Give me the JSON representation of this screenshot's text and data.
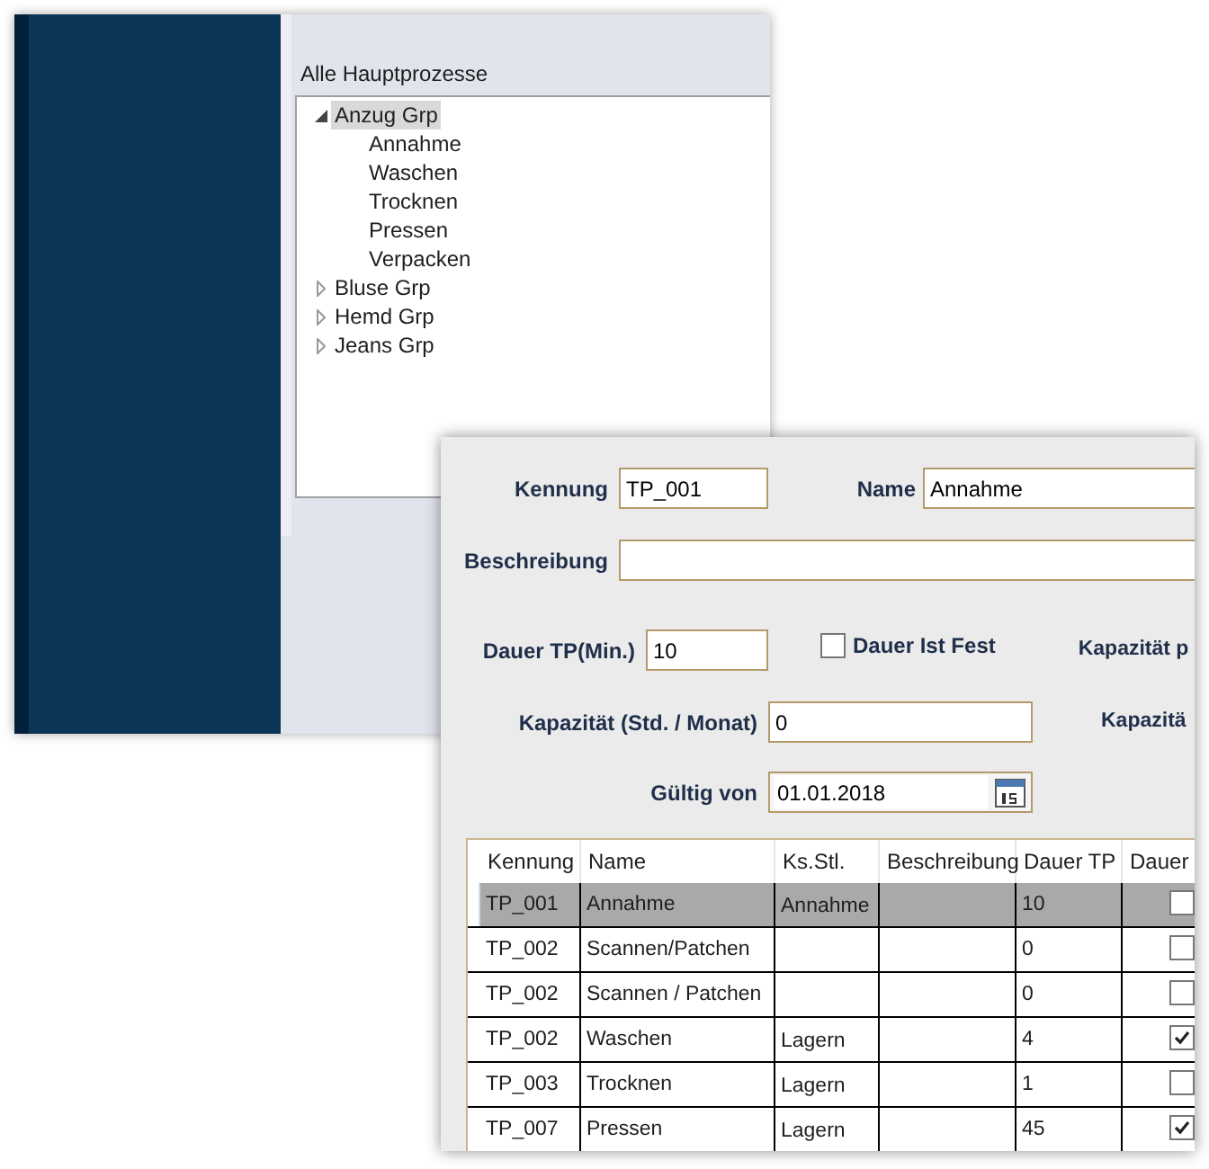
{
  "back_window": {
    "tree_title": "Alle Hauptprozesse",
    "tree": [
      {
        "label": "Anzug Grp",
        "expanded": true,
        "selected": true,
        "children": [
          {
            "label": "Annahme",
            "selected": false
          },
          {
            "label": "Waschen",
            "selected": false
          },
          {
            "label": "Trocknen",
            "selected": false
          },
          {
            "label": "Pressen",
            "selected": false
          },
          {
            "label": "Verpacken",
            "selected": false
          }
        ]
      },
      {
        "label": "Bluse Grp",
        "expanded": false,
        "selected": false
      },
      {
        "label": "Hemd Grp",
        "expanded": false,
        "selected": false
      },
      {
        "label": "Jeans Grp",
        "expanded": false,
        "selected": false
      }
    ]
  },
  "form": {
    "kennung": {
      "label": "Kennung",
      "value": "TP_001"
    },
    "name": {
      "label": "Name",
      "value": "Annahme"
    },
    "beschreibung": {
      "label": "Beschreibung"
    },
    "dauer": {
      "label": "Dauer TP(Min.)",
      "value": "10"
    },
    "dauer_fest": {
      "label": "Dauer Ist Fest",
      "checked": false
    },
    "kapazitaet_p_label": "Kapazität p",
    "kapazitaet": {
      "label": "Kapazität (Std. / Monat)",
      "value": "0"
    },
    "kapazitaet_2_label": "Kapazitä",
    "gueltig": {
      "label": "Gültig von",
      "value": "01.01.2018"
    }
  },
  "table": {
    "columns": [
      "Kennung",
      "Name",
      "Ks.Stl.",
      "Beschreibung",
      "Dauer TP",
      "Dauer"
    ],
    "rows": [
      {
        "cells": [
          "TP_001",
          "Annahme",
          "Annahme",
          "",
          "10"
        ],
        "checked": false,
        "selected": true
      },
      {
        "cells": [
          "TP_002",
          "Scannen/Patchen",
          "",
          "",
          "0"
        ],
        "checked": false,
        "selected": false
      },
      {
        "cells": [
          "TP_002",
          "Scannen / Patchen",
          "",
          "",
          "0"
        ],
        "checked": false,
        "selected": false
      },
      {
        "cells": [
          "TP_002",
          "Waschen",
          "Lagern",
          "",
          "4"
        ],
        "checked": true,
        "selected": false
      },
      {
        "cells": [
          "TP_003",
          "Trocknen",
          "Lagern",
          "",
          "1"
        ],
        "checked": false,
        "selected": false
      },
      {
        "cells": [
          "TP_007",
          "Pressen",
          "Lagern",
          "",
          "45"
        ],
        "checked": true,
        "selected": false
      }
    ]
  }
}
